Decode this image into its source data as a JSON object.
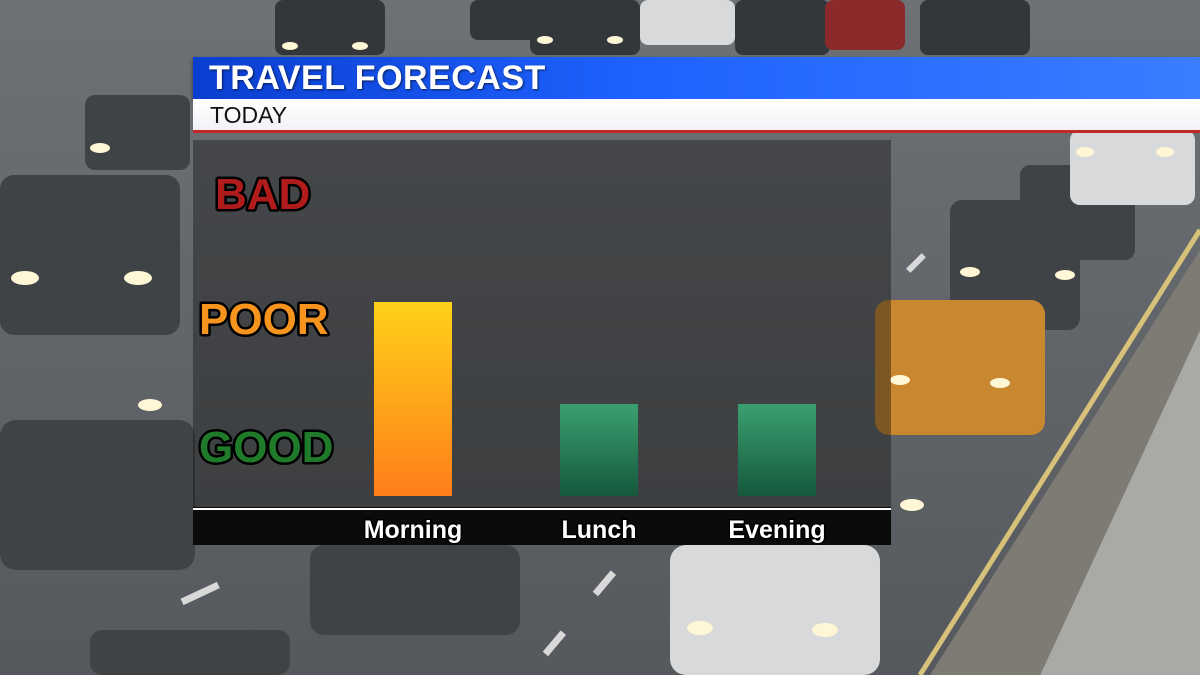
{
  "banner": {
    "title": "TRAVEL FORECAST",
    "subtitle": "TODAY"
  },
  "chart_data": {
    "type": "bar",
    "title": "TRAVEL FORECAST",
    "subtitle": "TODAY",
    "categories": [
      "Morning",
      "Lunch",
      "Evening"
    ],
    "values": [
      2,
      1,
      1
    ],
    "levels": [
      {
        "label": "GOOD",
        "value": 1,
        "color": "#1f7a2a"
      },
      {
        "label": "POOR",
        "value": 2,
        "color": "#f7941d"
      },
      {
        "label": "BAD",
        "value": 3,
        "color": "#b01c1c"
      }
    ],
    "value_labels": [
      "POOR",
      "GOOD",
      "GOOD"
    ],
    "ylim": [
      0,
      3
    ],
    "grid": false,
    "bar_colors": {
      "GOOD": [
        "#3aa070",
        "#15583c"
      ],
      "POOR": [
        "#ffd21a",
        "#ff7d1a"
      ]
    },
    "xlabel": "",
    "ylabel": ""
  }
}
